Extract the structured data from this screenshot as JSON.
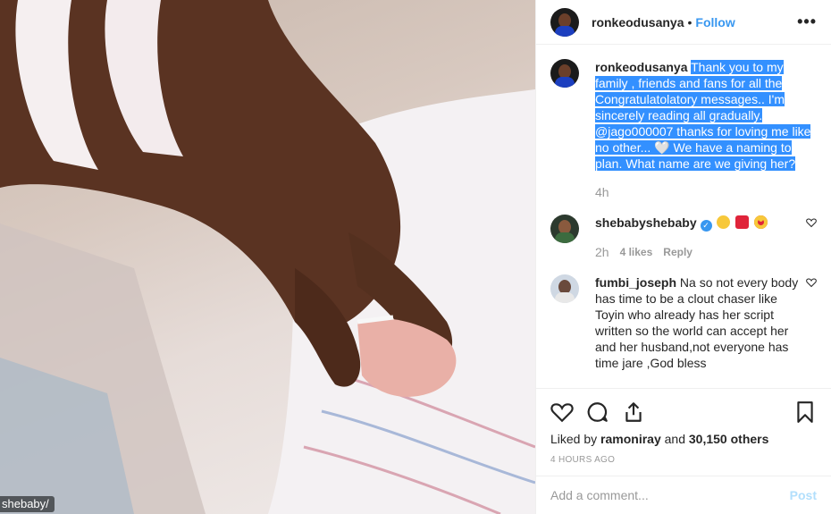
{
  "photo": {
    "tag_label": "shebaby/"
  },
  "header": {
    "username": "ronkeodusanya",
    "separator": "•",
    "follow_label": "Follow",
    "more_label": "•••"
  },
  "caption": {
    "username": "ronkeodusanya",
    "text": "Thank you to my family , friends and fans for all the Congratulatolatory messages.. I'm sincerely reading all gradually. @jago000007 thanks for loving me like no other... 🤍 We have a naming to plan. What name are we giving her?",
    "time": "4h"
  },
  "comments": [
    {
      "username": "shebabyshebaby",
      "verified_mark": "✓",
      "text": "",
      "time": "2h",
      "likes": "4 likes",
      "reply_label": "Reply"
    },
    {
      "username": "fumbi_joseph",
      "text": "Na so not every body has time to be a clout chaser like Toyin who already has her script written so the world can accept her and her husband,not everyone has time jare ,God bless"
    }
  ],
  "actions": {
    "liked_prefix": "Liked by",
    "liked_user": "ramoniray",
    "liked_and": "and",
    "liked_count": "30,150 others",
    "time_ago": "4 HOURS AGO"
  },
  "add_comment": {
    "placeholder": "Add a comment...",
    "post_label": "Post"
  },
  "colors": {
    "accent": "#3897f0",
    "selection": "#3390ff",
    "heart": "#ed4956"
  }
}
